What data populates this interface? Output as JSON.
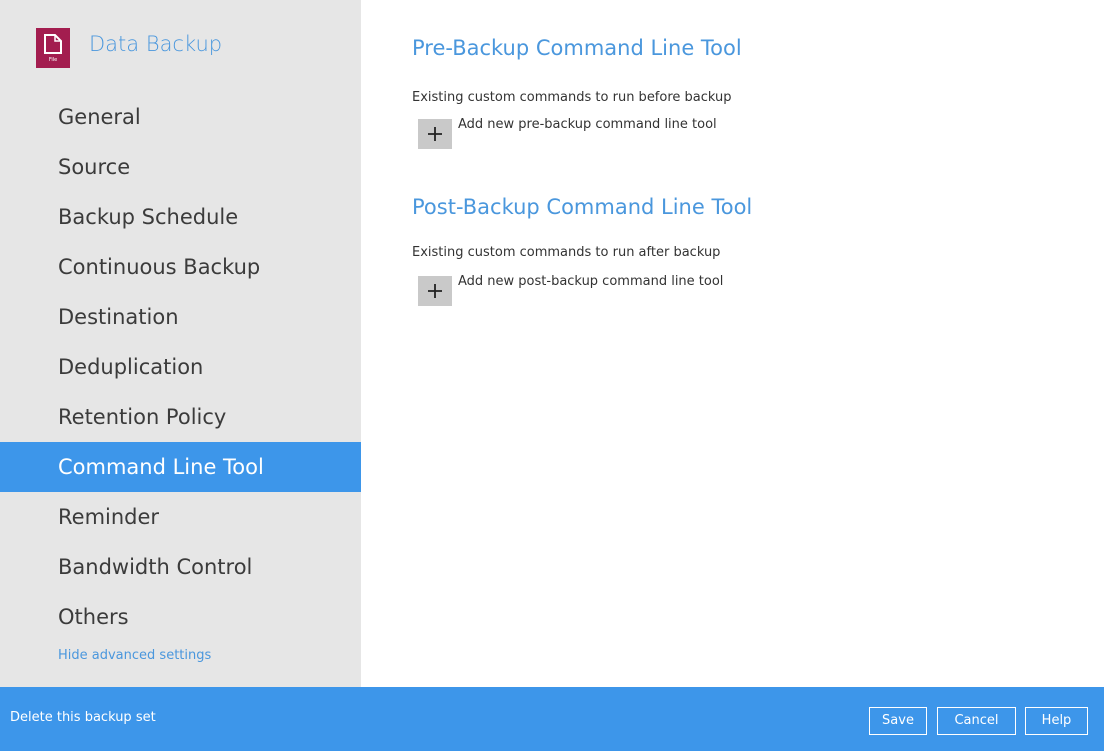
{
  "app": {
    "title": "Data Backup",
    "icon": "file-icon",
    "icon_caption": "File",
    "icon_color": "#a31d4f"
  },
  "sidebar": {
    "items": [
      {
        "label": "General"
      },
      {
        "label": "Source"
      },
      {
        "label": "Backup Schedule"
      },
      {
        "label": "Continuous Backup"
      },
      {
        "label": "Destination"
      },
      {
        "label": "Deduplication"
      },
      {
        "label": "Retention Policy"
      },
      {
        "label": "Command Line Tool",
        "active": true
      },
      {
        "label": "Reminder"
      },
      {
        "label": "Bandwidth Control"
      },
      {
        "label": "Others"
      }
    ],
    "hide_advanced_label": "Hide advanced settings"
  },
  "main": {
    "pre": {
      "title": "Pre-Backup Command Line Tool",
      "description": "Existing custom commands to run before backup",
      "add_label": "Add new pre-backup command line tool"
    },
    "post": {
      "title": "Post-Backup Command Line Tool",
      "description": "Existing custom commands to run after backup",
      "add_label": "Add new post-backup command line tool"
    }
  },
  "footer": {
    "delete_label": "Delete this backup set",
    "save_label": "Save",
    "cancel_label": "Cancel",
    "help_label": "Help"
  },
  "colors": {
    "accent": "#3d96ea",
    "title_blue": "#4a97dd",
    "sidebar_bg": "#e6e6e6"
  }
}
